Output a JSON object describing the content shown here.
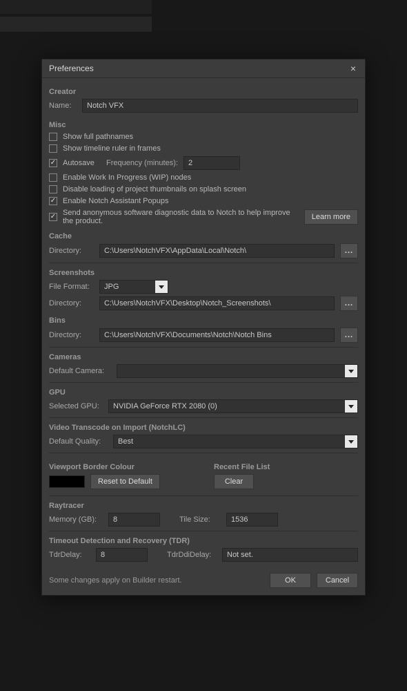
{
  "dialog": {
    "title": "Preferences",
    "close_icon": "×"
  },
  "creator": {
    "heading": "Creator",
    "name_label": "Name:",
    "name_value": "Notch VFX"
  },
  "misc": {
    "heading": "Misc",
    "show_full_pathnames": {
      "label": "Show full pathnames",
      "checked": false
    },
    "show_timeline_ruler": {
      "label": "Show timeline ruler in frames",
      "checked": false
    },
    "autosave": {
      "label": "Autosave",
      "checked": true
    },
    "frequency_label": "Frequency (minutes):",
    "frequency_value": "2",
    "enable_wip": {
      "label": "Enable Work In Progress (WIP) nodes",
      "checked": false
    },
    "disable_thumbnails": {
      "label": "Disable loading of project thumbnails on splash screen",
      "checked": false
    },
    "enable_assistant": {
      "label": "Enable Notch Assistant Popups",
      "checked": true
    },
    "send_diagnostic": {
      "label": "Send anonymous software diagnostic data to Notch to help improve the product.",
      "checked": true
    },
    "learn_more": "Learn more"
  },
  "cache": {
    "heading": "Cache",
    "directory_label": "Directory:",
    "directory_value": "C:\\Users\\NotchVFX\\AppData\\Local\\Notch\\",
    "browse": "..."
  },
  "screenshots": {
    "heading": "Screenshots",
    "file_format_label": "File Format:",
    "file_format_value": "JPG",
    "directory_label": "Directory:",
    "directory_value": "C:\\Users\\NotchVFX\\Desktop\\Notch_Screenshots\\",
    "browse": "..."
  },
  "bins": {
    "heading": "Bins",
    "directory_label": "Directory:",
    "directory_value": "C:\\Users\\NotchVFX\\Documents\\Notch\\Notch Bins",
    "browse": "..."
  },
  "cameras": {
    "heading": "Cameras",
    "default_label": "Default Camera:",
    "default_value": ""
  },
  "gpu": {
    "heading": "GPU",
    "selected_label": "Selected GPU:",
    "selected_value": "NVIDIA GeForce RTX 2080 (0)"
  },
  "transcode": {
    "heading": "Video Transcode on Import (NotchLC)",
    "quality_label": "Default Quality:",
    "quality_value": "Best"
  },
  "viewport": {
    "heading": "Viewport Border Colour",
    "color": "#000000",
    "reset": "Reset to Default"
  },
  "recent": {
    "heading": "Recent File List",
    "clear": "Clear"
  },
  "raytracer": {
    "heading": "Raytracer",
    "memory_label": "Memory (GB):",
    "memory_value": "8",
    "tile_label": "Tile Size:",
    "tile_value": "1536"
  },
  "tdr": {
    "heading": "Timeout Detection and Recovery (TDR)",
    "delay_label": "TdrDelay:",
    "delay_value": "8",
    "ddi_label": "TdrDdiDelay:",
    "ddi_value": "Not set."
  },
  "footer": {
    "note": "Some changes apply on Builder restart.",
    "ok": "OK",
    "cancel": "Cancel"
  }
}
